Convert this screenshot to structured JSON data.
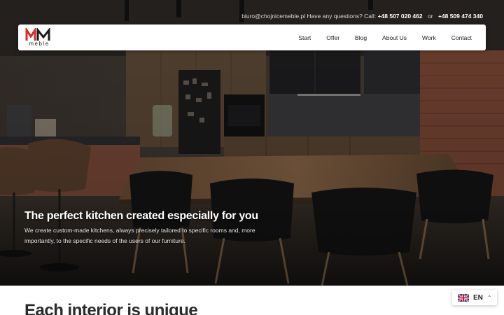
{
  "topbar": {
    "email_text": "biuro@chojnicemeble.pl",
    "question": "Have any questions? Call:",
    "phone1": "+48 507 020 462",
    "or": "or",
    "phone2": "+48 509 474 340"
  },
  "logo": {
    "mark": "MM",
    "brand": "meble"
  },
  "nav": {
    "items": [
      "Start",
      "Offer",
      "Blog",
      "About Us",
      "Work",
      "Contact"
    ]
  },
  "hero": {
    "title": "The perfect kitchen created especially for you",
    "subtitle": "We create custom-made kitchens, always precisely tailored to specific rooms and, more importantly, to the specific needs of the users of our furniture."
  },
  "section": {
    "heading": "Each interior is unique"
  },
  "language": {
    "code": "EN",
    "flag_icon": "uk-flag-icon",
    "chevron_icon": "chevron-up-icon"
  },
  "colors": {
    "logo_red": "#d62b2b",
    "text_dark": "#222222"
  }
}
